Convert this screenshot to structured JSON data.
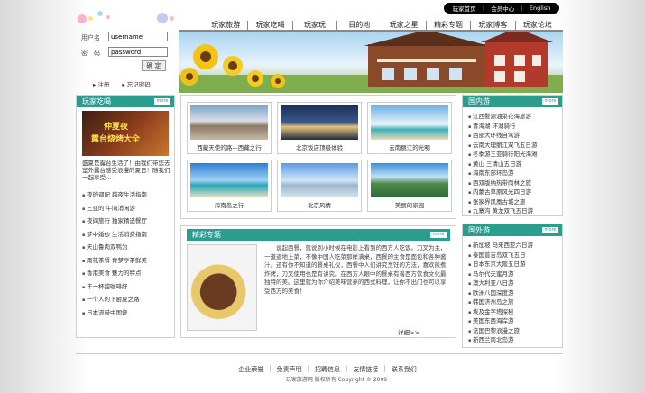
{
  "topbar": {
    "items": [
      "玩家首页",
      "会员中心",
      "English"
    ]
  },
  "nav": {
    "items": [
      "玩家旅游",
      "玩家吃喝",
      "玩家玩",
      "目的地",
      "玩家之星",
      "精彩专题",
      "玩家博客",
      "玩家论坛"
    ]
  },
  "login": {
    "user_label": "用户名",
    "pass_label": "密　码",
    "user_value": "username",
    "pass_value": "password",
    "confirm": "确 定",
    "register": "注册",
    "forgot": "忘记密码"
  },
  "left_panel": {
    "title": "玩家吃喝",
    "more": "more",
    "promo_line1": "仲夏夜",
    "promo_line2": "露台烧烤大全",
    "intro": "盛夏是露台生活了！由我们带您去室外露台感受浪漫的夏日！随我们一起享受…",
    "items": [
      "夜的调配 越夜生活指南",
      "三亚的 午间消闲游",
      "夜间旅行 独家精选餐厅",
      "梦中婚纱 生活消费指南",
      "天山鲁肉双鸭为",
      "雨花茶餐 青梦亭茶鲜美",
      "香港美食 魅力的特点",
      "丰一杯甜咖啡好",
      "一个人的下厨夏之路",
      "日本流鼓中国烧"
    ]
  },
  "photos": [
    {
      "caption": "西藏天使的路—西藏之行",
      "icon": "mountain-photo"
    },
    {
      "caption": "北京饭店顶级体验",
      "icon": "palace-photo"
    },
    {
      "caption": "云南丽江的光明",
      "icon": "beach-photo"
    },
    {
      "caption": "海南岛之行",
      "icon": "island-photo"
    },
    {
      "caption": "北京风情",
      "icon": "lake-photo"
    },
    {
      "caption": "美丽的家园",
      "icon": "karst-photo"
    }
  ],
  "feature": {
    "title": "精彩专题",
    "more": "more",
    "text": "说起西餐，就说到小时候在电影上看到的西方人吃饭。刀叉为主，一道道地上菜，不像中国人吃菜那样满桌，西餐的主食是面包和各种酱汁。还有你不知道的餐桌礼仪，西餐中人们讲究烹饪的方法，喜欢煎煮炸烤，刀叉使用也是有讲究。在西方人眼中的餐桌有着西方饮食文化最独特的美。这里就为你介绍美味营养的西式料理，让你不出门也可以享受西方的美食！",
    "detail": "详细>>"
  },
  "right_panel_1": {
    "title": "国内游",
    "more": "more",
    "items": [
      "江西婺源油菜花海旅游",
      "青海湖 环湖骑行",
      "西部大环线自驾游",
      "云南大理丽江双飞五日游",
      "冬季游三亚骑行阳光海滩",
      "黄山 三清山五日游",
      "海南东部环岛游",
      "西双版纳热带雨林之旅",
      "内蒙古草原风光四日游",
      "张家界凤凰古城之旅",
      "九寨沟 黄龙双飞五日游"
    ]
  },
  "right_panel_2": {
    "title": "国外游",
    "more": "more",
    "items": [
      "新加坡 马来西亚六日游",
      "泰国普吉岛双飞五日",
      "日本东京大阪五日游",
      "马尔代夫蜜月游",
      "澳大利亚八日游",
      "欧洲八国深度游",
      "韩国济州岛之旅",
      "埃及金字塔探秘",
      "美国东西海岸游",
      "法国巴黎浪漫之旅",
      "新西兰南北岛游"
    ]
  },
  "footer": {
    "links": [
      "企业荣誉",
      "免责声明",
      "招聘信息",
      "友情链接",
      "联系我们"
    ],
    "copyright": "玩家旅游网 版权所有 Copyright © 2009"
  },
  "colors": {
    "accent": "#2a9d8f",
    "nav_text": "#222222"
  }
}
